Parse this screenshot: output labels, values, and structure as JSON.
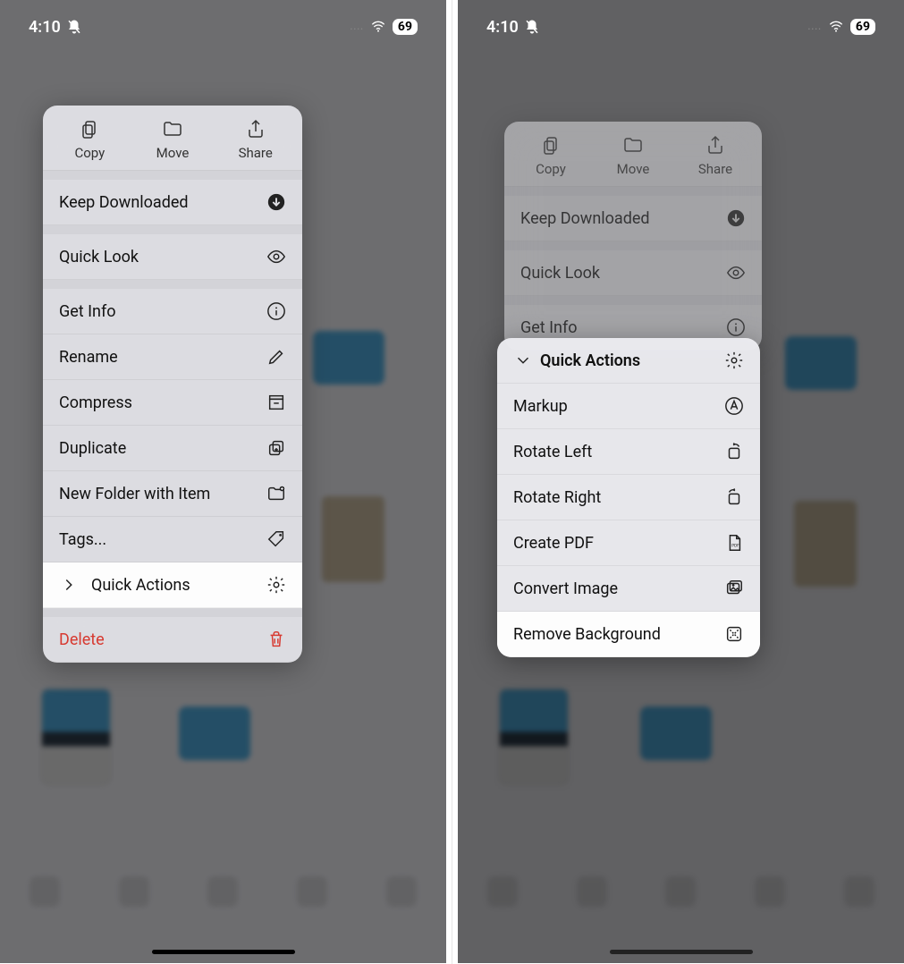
{
  "status": {
    "time": "4:10",
    "battery": "69"
  },
  "menu": {
    "top": {
      "copy": "Copy",
      "move": "Move",
      "share": "Share"
    },
    "items": {
      "keep_downloaded": "Keep Downloaded",
      "quick_look": "Quick Look",
      "get_info": "Get Info",
      "rename": "Rename",
      "compress": "Compress",
      "duplicate": "Duplicate",
      "new_folder_with_item": "New Folder with Item",
      "tags": "Tags...",
      "quick_actions": "Quick Actions",
      "delete": "Delete"
    }
  },
  "submenu": {
    "header": "Quick Actions",
    "items": {
      "markup": "Markup",
      "rotate_left": "Rotate Left",
      "rotate_right": "Rotate Right",
      "create_pdf": "Create PDF",
      "convert_image": "Convert Image",
      "remove_background": "Remove Background"
    }
  }
}
